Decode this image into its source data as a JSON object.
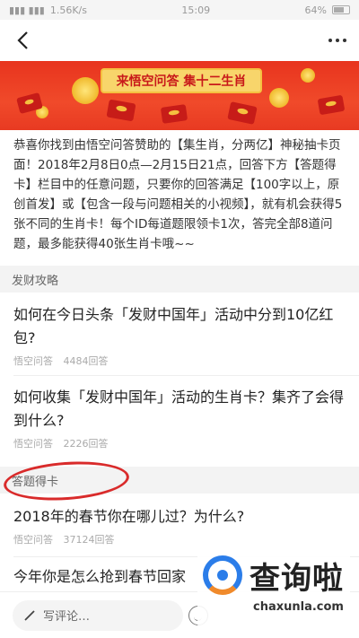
{
  "status_bar": {
    "signal": "▮▮▮ ▮▮▮",
    "speed": "1.56K/s",
    "time": "15:09",
    "battery": "64%"
  },
  "banner": {
    "title": "来悟空问答 集十二生肖"
  },
  "intro": {
    "text": "恭喜你找到由悟空问答赞助的【集生肖，分两亿】神秘抽卡页面！2018年2月8日0点—2月15日21点，回答下方【答题得卡】栏目中的任意问题，只要你的回答满足【100字以上，原创首发】或【包含一段与问题相关的小视频】，就有机会获得5张不同的生肖卡！每个ID每道题限领卡1次，答完全部8道问题，最多能获得40张生肖卡哦~~"
  },
  "sections": [
    {
      "header": "发财攻略",
      "items": [
        {
          "title": "如何在今日头条「发财中国年」活动中分到10亿红包?",
          "source": "悟空问答",
          "count": "4484回答"
        },
        {
          "title": "如何收集「发财中国年」活动的生肖卡？集齐了会得到什么?",
          "source": "悟空问答",
          "count": "2226回答"
        }
      ]
    },
    {
      "header": "答题得卡",
      "items": [
        {
          "title": "2018年的春节你在哪儿过？为什么?",
          "source": "悟空问答",
          "count": "37124回答"
        },
        {
          "title": "今年你是怎么抢到春节回家",
          "source": "",
          "count": ""
        }
      ]
    }
  ],
  "bottom_bar": {
    "comment_placeholder": "写评论…"
  },
  "watermark": {
    "brand": "查询啦",
    "url": "chaxunla.com"
  },
  "colors": {
    "banner_red": "#e8341e",
    "annotation_red": "#d92b2b",
    "gold": "#f8d56b"
  }
}
